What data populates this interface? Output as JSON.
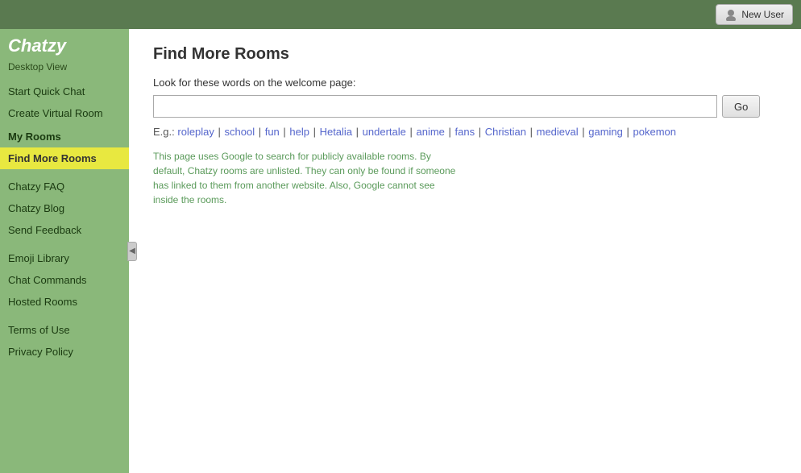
{
  "topbar": {
    "new_user_label": "New User"
  },
  "sidebar": {
    "logo": "Chatzy",
    "desktop_view": "Desktop View",
    "items": [
      {
        "id": "start-quick-chat",
        "label": "Start Quick Chat",
        "active": false
      },
      {
        "id": "create-virtual-room",
        "label": "Create Virtual Room",
        "active": false
      },
      {
        "id": "my-rooms",
        "label": "My Rooms",
        "active": false,
        "bold": true
      },
      {
        "id": "find-more-rooms",
        "label": "Find More Rooms",
        "active": true
      },
      {
        "id": "chatzy-faq",
        "label": "Chatzy FAQ",
        "active": false
      },
      {
        "id": "chatzy-blog",
        "label": "Chatzy Blog",
        "active": false
      },
      {
        "id": "send-feedback",
        "label": "Send Feedback",
        "active": false
      },
      {
        "id": "emoji-library",
        "label": "Emoji Library",
        "active": false
      },
      {
        "id": "chat-commands",
        "label": "Chat Commands",
        "active": false
      },
      {
        "id": "hosted-rooms",
        "label": "Hosted Rooms",
        "active": false
      },
      {
        "id": "terms-of-use",
        "label": "Terms of Use",
        "active": false
      },
      {
        "id": "privacy-policy",
        "label": "Privacy Policy",
        "active": false
      }
    ]
  },
  "main": {
    "title": "Find More Rooms",
    "search_label": "Look for these words on the welcome page:",
    "search_placeholder": "",
    "go_button": "Go",
    "examples_prefix": "E.g.:",
    "examples": [
      "roleplay",
      "school",
      "fun",
      "help",
      "Hetalia",
      "undertale",
      "anime",
      "fans",
      "Christian",
      "medieval",
      "gaming",
      "pokemon"
    ],
    "info_text": "This page uses Google to search for publicly available rooms. By default, Chatzy rooms are unlisted. They can only be found if someone has linked to them from another website. Also, Google cannot see inside the rooms."
  }
}
